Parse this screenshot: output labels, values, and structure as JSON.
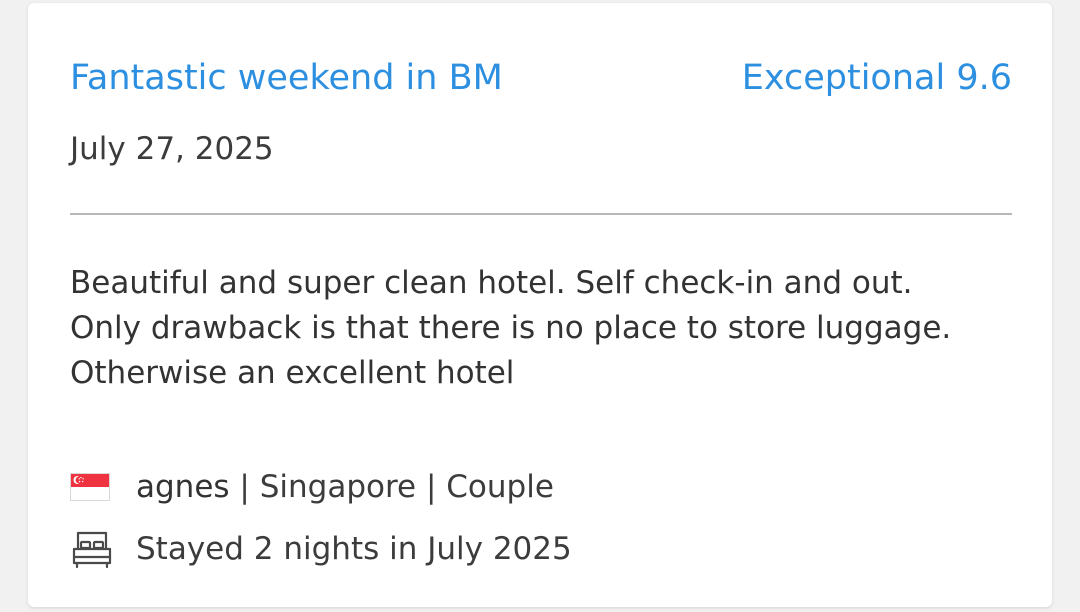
{
  "review": {
    "title": "Fantastic weekend in BM",
    "rating_label": "Exceptional 9.6",
    "date": "July 27, 2025",
    "body": "Beautiful and super clean hotel. Self check-in and out. Only drawback is that there is no place to store luggage. Otherwise an excellent hotel"
  },
  "reviewer": {
    "name": "agnes",
    "separator": " | ",
    "country": "Singapore",
    "traveler_type": "Couple",
    "flag_icon": "singapore-flag-icon"
  },
  "stay": {
    "text": "Stayed 2 nights in July 2025",
    "icon": "bed-icon"
  },
  "colors": {
    "accent": "#2d8fe0",
    "text": "#3c3c3c",
    "divider": "#b8b8b8",
    "flag_red": "#ef3340"
  }
}
